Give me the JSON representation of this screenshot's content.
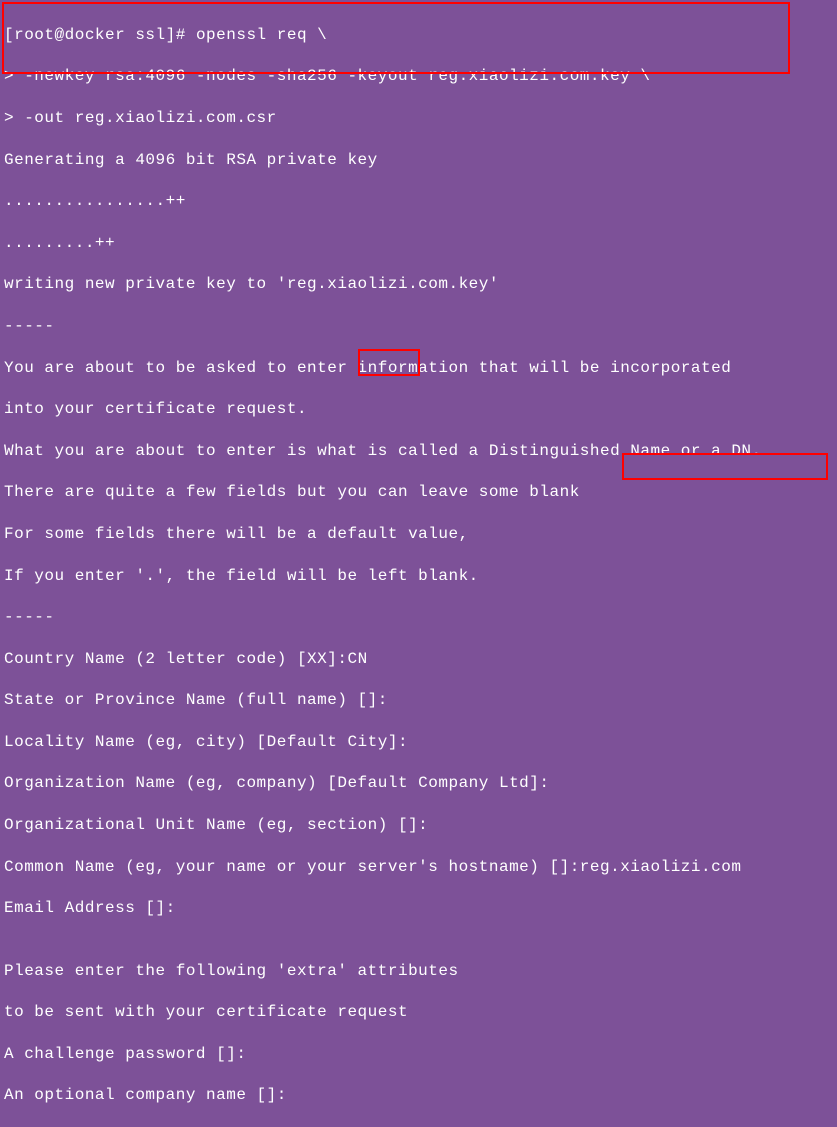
{
  "terminal": {
    "prompt": "[root@docker ssl]# ",
    "command_line_1": "openssl req \\",
    "command_line_2": "> -newkey rsa:4096 -nodes -sha256 -keyout reg.xiaolizi.com.key \\",
    "command_line_3": "> -out reg.xiaolizi.com.csr",
    "output_1": "Generating a 4096 bit RSA private key",
    "output_2": "................++",
    "output_3": ".........++",
    "output_4": "writing new private key to 'reg.xiaolizi.com.key'",
    "output_5": "-----",
    "output_6": "You are about to be asked to enter information that will be incorporated",
    "output_7": "into your certificate request.",
    "output_8": "What you are about to enter is what is called a Distinguished Name or a DN.",
    "output_9": "There are quite a few fields but you can leave some blank",
    "output_10": "For some fields there will be a default value,",
    "output_11": "If you enter '.', the field will be left blank.",
    "output_12": "-----",
    "prompt_country": "Country Name (2 letter code) [XX]",
    "input_country": ":CN",
    "prompt_state": "State or Province Name (full name) []:",
    "prompt_locality": "Locality Name (eg, city) [Default City]:",
    "prompt_org": "Organization Name (eg, company) [Default Company Ltd]:",
    "prompt_ou": "Organizational Unit Name (eg, section) []:",
    "prompt_cn": "Common Name (eg, your name or your server's hostname) []",
    "input_cn": ":reg.xiaolizi.com",
    "prompt_email": "Email Address []:",
    "blank_line": "",
    "output_extra_1": "Please enter the following 'extra' attributes",
    "output_extra_2": "to be sent with your certificate request",
    "prompt_challenge": "A challenge password []:",
    "prompt_optional": "An optional company name []:"
  }
}
